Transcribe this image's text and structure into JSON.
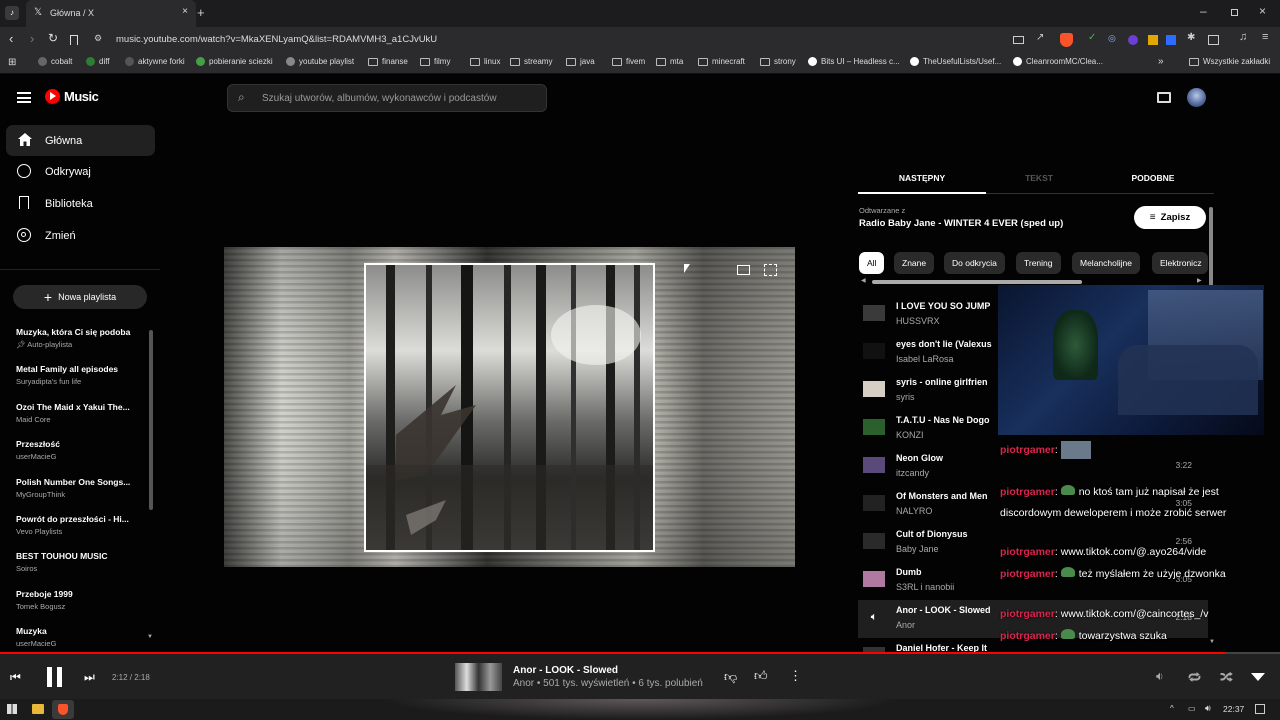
{
  "browser": {
    "tab_title": "Główna / X",
    "url": "music.youtube.com/watch?v=MkaXENLyamQ&list=RDAMVMH3_a1CJvUkU",
    "bookmarks": [
      "cobalt",
      "diff",
      "aktywne forki",
      "pobieranie sciezki",
      "youtube playlist",
      "finanse",
      "filmy",
      "linux",
      "streamy",
      "java",
      "fivem",
      "mta",
      "minecraft",
      "strony",
      "Bits UI – Headless c...",
      "TheUsefulLists/Usef...",
      "CleanroomMC/Clea..."
    ],
    "all_bookmarks": "Wszystkie zakładki"
  },
  "app": {
    "logo": "Music",
    "search_placeholder": "Szukaj utworów, albumów, wykonawców i podcastów",
    "nav": [
      "Główna",
      "Odkrywaj",
      "Biblioteka",
      "Zmień"
    ],
    "new_playlist": "Nowa playlista",
    "playlists": [
      {
        "title": "Muzyka, która Ci się podoba",
        "sub": "Auto-playlista"
      },
      {
        "title": "Metal Family all episodes",
        "sub": "Suryadipta's fun life"
      },
      {
        "title": "Ozoi The Maid x Yakui The...",
        "sub": "Maid Core"
      },
      {
        "title": "Przeszłość",
        "sub": "userMacieG"
      },
      {
        "title": "Polish Number One Songs...",
        "sub": "MyGroupThink"
      },
      {
        "title": "Powrót do przeszłości - Hi...",
        "sub": "Vevo Playlists"
      },
      {
        "title": "BEST TOUHOU MUSIC",
        "sub": "Soiros"
      },
      {
        "title": "Przeboje 1999",
        "sub": "Tomek Bogusz"
      },
      {
        "title": "Muzyka",
        "sub": "userMacieG"
      }
    ]
  },
  "panel": {
    "tabs": [
      "NASTĘPNY",
      "TEKST",
      "PODOBNE"
    ],
    "playing_from_label": "Odtwarzane z",
    "playing_from": "Radio Baby Jane - WINTER 4 EVER (sped up)",
    "save": "Zapisz",
    "chips": [
      "All",
      "Znane",
      "Do odkrycia",
      "Trening",
      "Melancholijne",
      "Elektronicz"
    ],
    "queue": [
      {
        "title": "I LOVE YOU SO JUMP",
        "artist": "HUSSVRX",
        "dur": ""
      },
      {
        "title": "eyes don't lie (Valexus",
        "artist": "Isabel LaRosa",
        "dur": ""
      },
      {
        "title": "syris - online girlfrien",
        "artist": "syris",
        "dur": ""
      },
      {
        "title": "T.A.T.U - Nas Ne Dogo",
        "artist": "KONZI",
        "dur": ""
      },
      {
        "title": "Neon Glow",
        "artist": "itzcandy",
        "dur": "3:22"
      },
      {
        "title": "Of Monsters and Men",
        "artist": "NALYRO",
        "dur": "3:05"
      },
      {
        "title": "Cult of Dionysus",
        "artist": "Baby Jane",
        "dur": "2:56"
      },
      {
        "title": "Dumb",
        "artist": "S3RL i nanobii",
        "dur": "3:05"
      },
      {
        "title": "Anor - LOOK - Slowed",
        "artist": "Anor",
        "dur": "2:18"
      },
      {
        "title": "Daniel Hofer - Keep It",
        "artist": "",
        "dur": ""
      }
    ]
  },
  "chat": [
    {
      "user": "piotrgamer",
      "msg": ""
    },
    {
      "user": "piotrgamer",
      "msg": "no ktoś tam już napisał że jest discordowym deweloperem i może zrobić serwer"
    },
    {
      "user": "piotrgamer",
      "msg": "www.tiktok.com/@.ayo264/vide"
    },
    {
      "user": "piotrgamer",
      "msg": "też myślałem że użyje dzwonka"
    },
    {
      "user": "piotrgamer",
      "msg": "www.tiktok.com/@caincortes_/v"
    },
    {
      "user": "piotrgamer",
      "msg": "towarzystwa szuka"
    }
  ],
  "player": {
    "time": "2:12 / 2:18",
    "progress": 0.957,
    "title": "Anor - LOOK - Slowed",
    "meta": "Anor • 501 tys. wyświetleń • 6 tys. polubień"
  },
  "taskbar": {
    "clock": "22:37"
  }
}
